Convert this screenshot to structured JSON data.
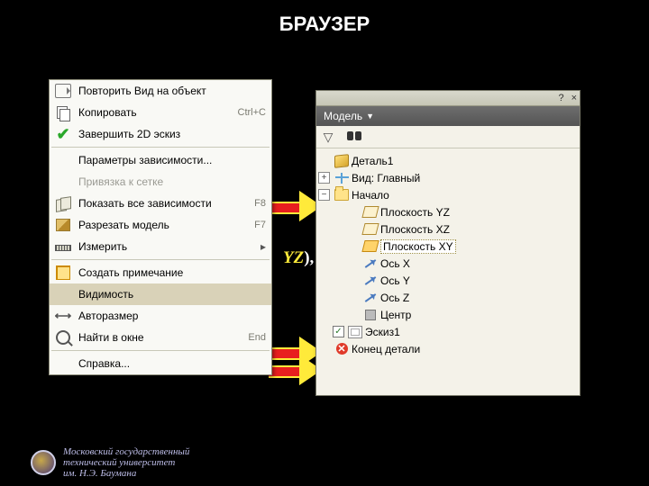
{
  "slide_title": "БРАУЗЕР",
  "yz_fragment": "YZ",
  "context_menu": {
    "items": [
      {
        "key": "repeat",
        "label": "Повторить Вид на объект",
        "accel": "",
        "enabled": true,
        "icon": "repeat"
      },
      {
        "key": "copy",
        "label": "Копировать",
        "accel": "Ctrl+C",
        "enabled": true,
        "icon": "copy"
      },
      {
        "key": "finish",
        "label": "Завершить 2D эскиз",
        "accel": "",
        "enabled": true,
        "icon": "check"
      },
      {
        "sep": true
      },
      {
        "key": "params",
        "label": "Параметры зависимости...",
        "accel": "",
        "enabled": true,
        "icon": ""
      },
      {
        "key": "grid",
        "label": "Привязка к сетке",
        "accel": "",
        "enabled": false,
        "icon": ""
      },
      {
        "key": "showdep",
        "label": "Показать все зависимости",
        "accel": "F8",
        "enabled": true,
        "icon": "sheets"
      },
      {
        "key": "slice",
        "label": "Разрезать модель",
        "accel": "F7",
        "enabled": true,
        "icon": "slice"
      },
      {
        "key": "measure",
        "label": "Измерить",
        "accel": "",
        "enabled": true,
        "icon": "ruler",
        "submenu": true
      },
      {
        "sep": true
      },
      {
        "key": "annot",
        "label": "Создать примечание",
        "accel": "",
        "enabled": true,
        "icon": "note"
      },
      {
        "key": "vis",
        "label": "Видимость",
        "accel": "",
        "enabled": true,
        "highlight": true,
        "icon": ""
      },
      {
        "key": "autodim",
        "label": "Авторазмер",
        "accel": "",
        "enabled": true,
        "icon": "dim"
      },
      {
        "key": "find",
        "label": "Найти в окне",
        "accel": "End",
        "enabled": true,
        "icon": "find"
      },
      {
        "sep": true
      },
      {
        "key": "help",
        "label": "Справка...",
        "accel": "",
        "enabled": true,
        "icon": ""
      }
    ]
  },
  "panel": {
    "close": "×",
    "help": "?",
    "header": "Модель",
    "tree": {
      "root": "Деталь1",
      "view": "Вид: Главный",
      "origin": "Начало",
      "planes": [
        "Плоскость YZ",
        "Плоскость XZ",
        "Плоскость XY"
      ],
      "selected_plane": "Плоскость XY",
      "axes": [
        "Ось X",
        "Ось Y",
        "Ось Z"
      ],
      "center": "Центр",
      "sketch": "Эскиз1",
      "end": "Конец детали"
    }
  },
  "footer": {
    "l1": "Московский государственный",
    "l2": "технический университет",
    "l3": "им. Н.Э. Баумана"
  }
}
